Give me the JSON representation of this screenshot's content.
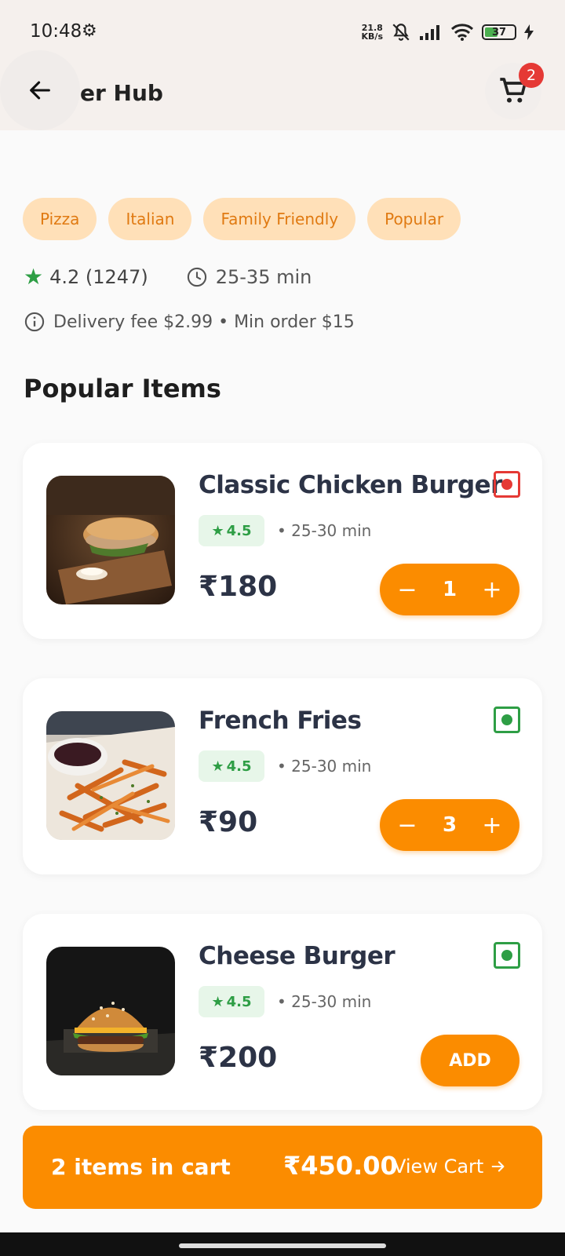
{
  "status": {
    "time": "10:48",
    "net_speed_top": "21.8",
    "net_speed_bottom": "KB/s",
    "battery": "37"
  },
  "header": {
    "title": "er Hub",
    "cart_count": "2"
  },
  "tags": [
    "Pizza",
    "Italian",
    "Family Friendly",
    "Popular"
  ],
  "restaurant": {
    "rating": "4.2 (1247)",
    "delivery_time": "25-35 min",
    "delivery_info": "Delivery fee $2.99 • Min order $15"
  },
  "section": {
    "title": "Popular Items"
  },
  "items": [
    {
      "name": "Classic Chicken Burger",
      "rating": "4.5",
      "time": "• 25-30 min",
      "price": "₹180",
      "qty": "1",
      "type": "non-veg",
      "mark_color": "#e53935"
    },
    {
      "name": "French Fries",
      "rating": "4.5",
      "time": "• 25-30 min",
      "price": "₹90",
      "qty": "3",
      "type": "veg",
      "mark_color": "#2e9e45"
    },
    {
      "name": "Cheese Burger",
      "rating": "4.5",
      "time": "• 25-30 min",
      "price": "₹200",
      "add_label": "ADD",
      "type": "veg",
      "mark_color": "#2e9e45"
    }
  ],
  "cart_bar": {
    "count_label": "2 items in cart",
    "total": "₹450.00",
    "view_label": "View Cart"
  },
  "colors": {
    "accent": "#fb8c00",
    "tag_bg": "#ffe0b8",
    "tag_text": "#e07a12",
    "rating_green": "#2e9e45",
    "badge_red": "#e53935"
  }
}
